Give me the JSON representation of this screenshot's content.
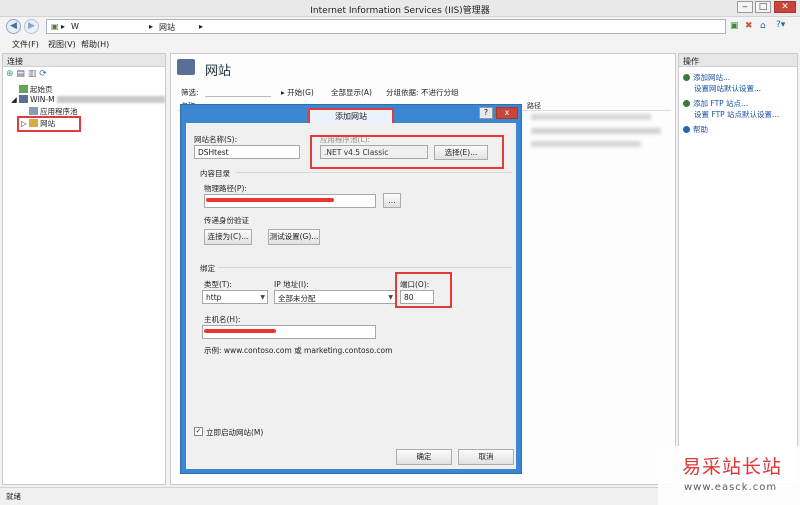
{
  "window": {
    "title": "Internet Information Services (IIS)管理器"
  },
  "address": {
    "host": "W",
    "path": "网站"
  },
  "menu": [
    "文件(F)",
    "视图(V)",
    "帮助(H)"
  ],
  "left": {
    "header": "连接",
    "tree": [
      {
        "label": "起始页"
      },
      {
        "label": "WIN-M"
      },
      {
        "label": "应用程序池"
      },
      {
        "label": "网站"
      }
    ]
  },
  "center": {
    "title": "网站",
    "filter_label": "筛选:",
    "start_label": "▸ 开始(G)",
    "show_all_label": "全部显示(A)",
    "group_label": "分组依据:",
    "group_value": "不进行分组",
    "col_name": "名称",
    "col_path": "路径"
  },
  "right": {
    "header": "操作",
    "actions": [
      "添加网站...",
      "设置网站默认设置...",
      "添加 FTP 站点...",
      "设置 FTP 站点默认设置...",
      "帮助"
    ]
  },
  "dialog": {
    "title": "添加网站",
    "help_btn": "?",
    "close_btn": "x",
    "site_name_label": "网站名称(S):",
    "site_name_value": "DSHtest",
    "app_pool_label": "应用程序池(L):",
    "app_pool_value": ".NET v4.5 Classic",
    "select_btn": "选择(E)...",
    "content_dir_label": "内容目录",
    "physical_path_label": "物理路径(P):",
    "browse_btn": "...",
    "passthrough_label": "传递身份验证",
    "connect_as_btn": "连接为(C)...",
    "test_settings_btn": "测试设置(G)...",
    "binding_label": "绑定",
    "type_label": "类型(T):",
    "type_value": "http",
    "ip_label": "IP 地址(I):",
    "ip_value": "全部未分配",
    "port_label": "端口(O):",
    "port_value": "80",
    "hostname_label": "主机名(H):",
    "example_text": "示例: www.contoso.com 或 marketing.contoso.com",
    "start_now_label": "立即启动网站(M)",
    "ok_btn": "确定",
    "cancel_btn": "取消"
  },
  "status": {
    "text": "就绪"
  },
  "watermark": {
    "brand": "易采站长站",
    "url": "www.easck.com"
  },
  "colors": {
    "dialog_frame": "#3b88d0",
    "annotation_red": "#e23b3b",
    "link": "#1a52a8",
    "watermark_red": "#e0262b"
  }
}
